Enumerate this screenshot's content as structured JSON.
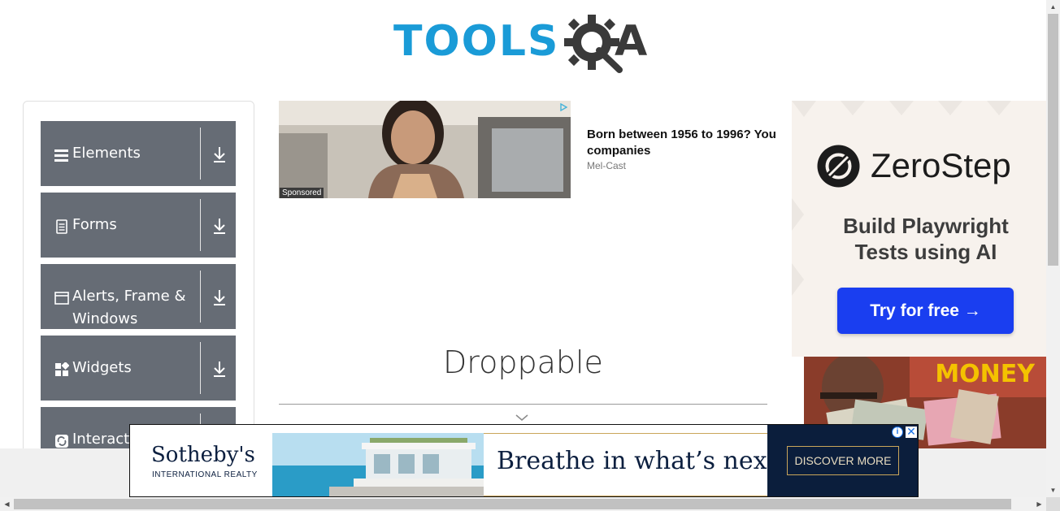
{
  "header": {
    "logo_text": "TOOLS",
    "logo_suffix": "A"
  },
  "sidebar": {
    "groups": [
      {
        "label": "Elements",
        "icon": "hamburger-icon"
      },
      {
        "label": "Forms",
        "icon": "document-icon"
      },
      {
        "label": "Alerts, Frame & Windows",
        "icon": "window-icon"
      },
      {
        "label": "Widgets",
        "icon": "widgets-icon"
      },
      {
        "label": "Interactions",
        "icon": "interactions-icon"
      }
    ]
  },
  "ad_top": {
    "sponsored": "Sponsored",
    "headline": "Born between 1956 to 1996? You companies",
    "source": "Mel-Cast"
  },
  "main": {
    "title": "Droppable"
  },
  "ad_right": {
    "brand": "ZeroStep",
    "tagline": "Build Playwright Tests using AI",
    "cta": "Try for free →",
    "money_text": "MONEY"
  },
  "ad_bottom": {
    "brand_name": "Sotheby's",
    "brand_sub": "INTERNATIONAL REALTY",
    "slogan": "Breathe in what’s next.",
    "cta": "DISCOVER MORE",
    "info": "i",
    "close": "✕"
  },
  "colors": {
    "logo_blue": "#1a9bd7",
    "logo_dark": "#3a3a3a",
    "sidebar_group_bg": "#666c75",
    "zerostep_button": "#1a3ef0",
    "sothebys_navy": "#0b1e3c"
  }
}
